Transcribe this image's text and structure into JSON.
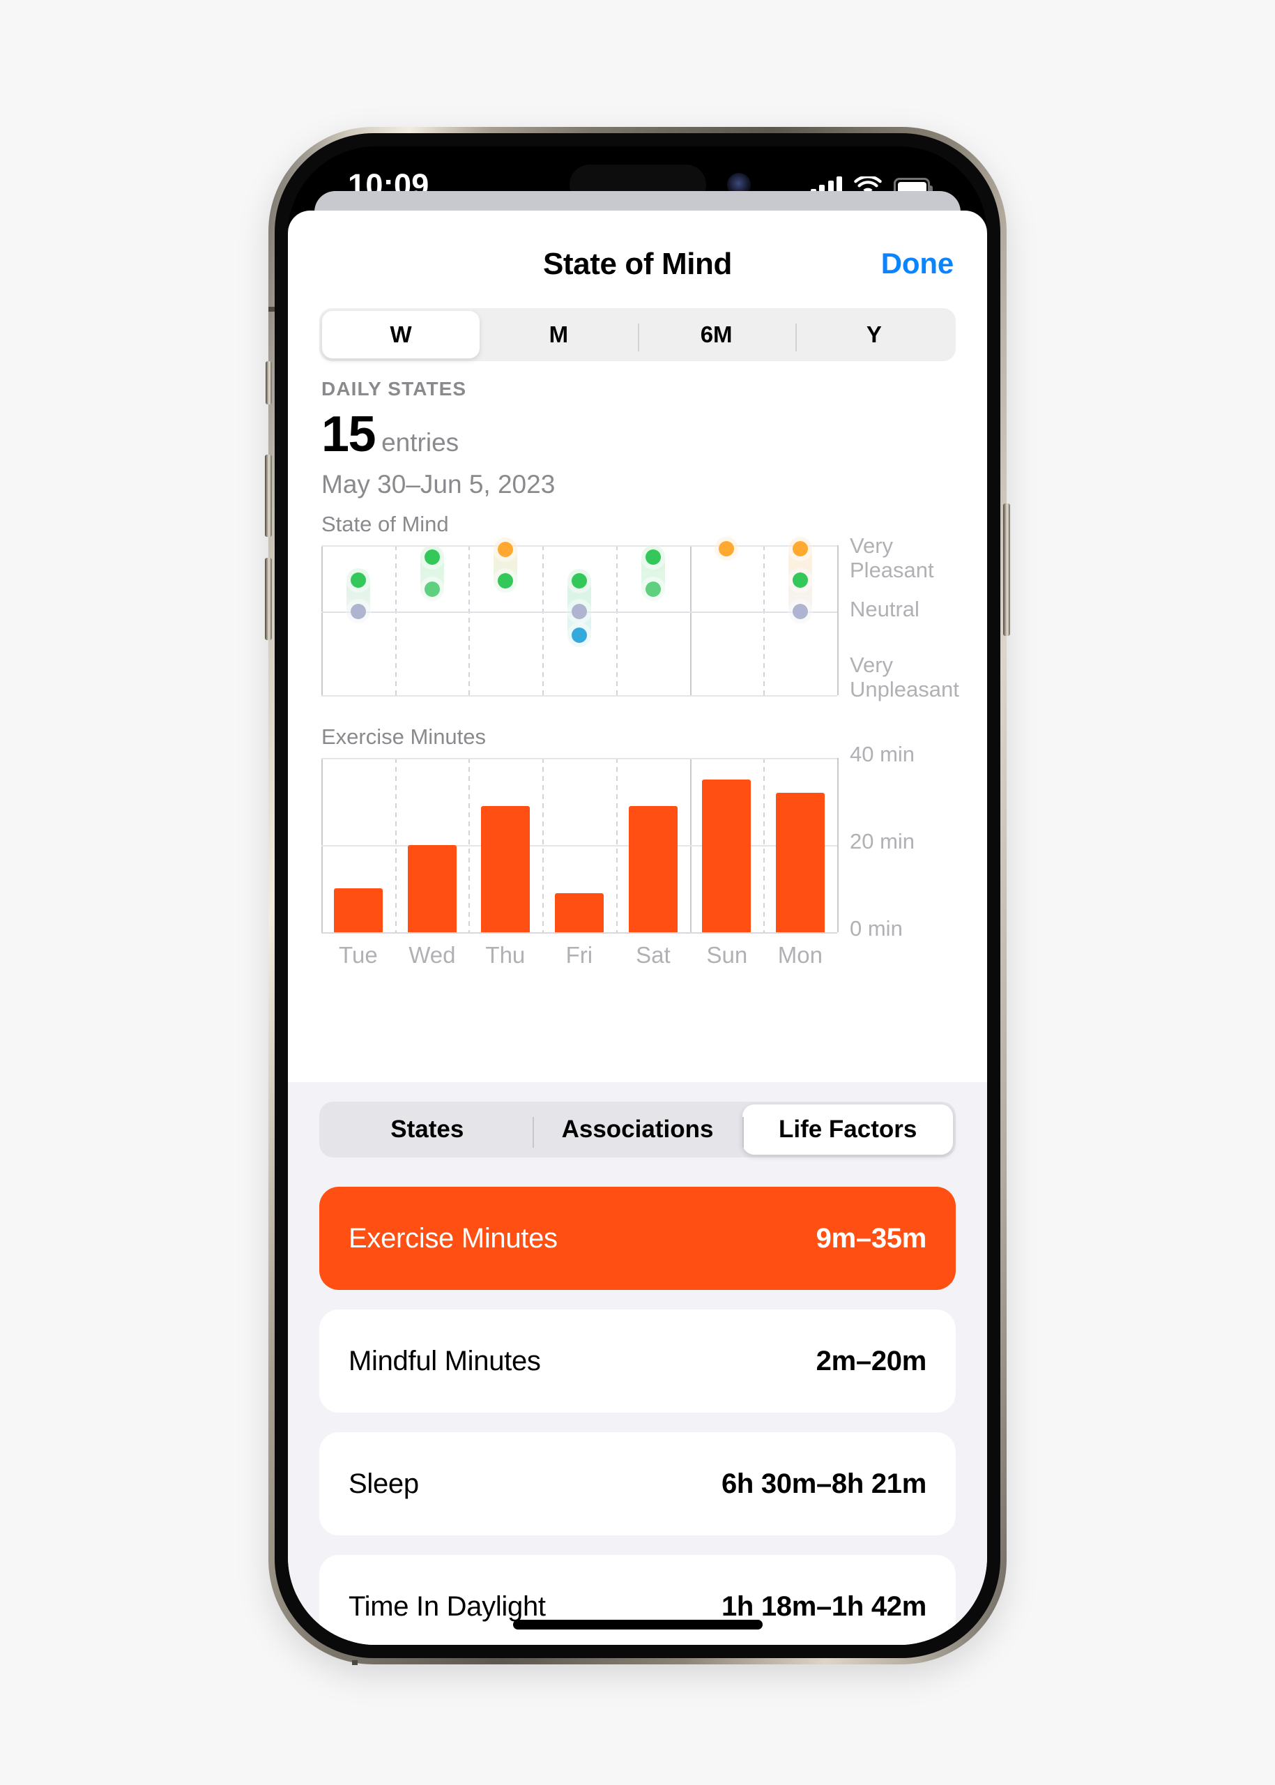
{
  "status_bar": {
    "time": "10:09",
    "cellular_icon": "cellular-bars-icon",
    "wifi_icon": "wifi-icon",
    "battery_icon": "battery-full-icon"
  },
  "nav": {
    "title": "State of Mind",
    "done_label": "Done"
  },
  "range_segments": [
    {
      "label": "W",
      "active": true
    },
    {
      "label": "M",
      "active": false
    },
    {
      "label": "6M",
      "active": false
    },
    {
      "label": "Y",
      "active": false
    }
  ],
  "stats": {
    "section_label": "DAILY STATES",
    "count": "15",
    "unit": "entries",
    "date_range": "May 30–Jun 5, 2023"
  },
  "view_segments": [
    {
      "label": "States",
      "active": false
    },
    {
      "label": "Associations",
      "active": false
    },
    {
      "label": "Life Factors",
      "active": true
    }
  ],
  "life_factors": [
    {
      "name": "Exercise Minutes",
      "value": "9m–35m",
      "highlight": true
    },
    {
      "name": "Mindful Minutes",
      "value": "2m–20m",
      "highlight": false
    },
    {
      "name": "Sleep",
      "value": "6h 30m–8h 21m",
      "highlight": false
    },
    {
      "name": "Time In Daylight",
      "value": "1h 18m–1h 42m",
      "highlight": false
    }
  ],
  "colors": {
    "accent_orange": "#FF4F12",
    "link_blue": "#0A84FF",
    "mood_green": "#34C759",
    "mood_light_green": "#5FD07F",
    "mood_orange": "#FFA930",
    "mood_neutral": "#AFB4D0",
    "mood_blue": "#34AADC",
    "grey_bg": "#F2F2F7"
  },
  "chart_data": [
    {
      "type": "scatter",
      "title": "State of Mind",
      "xlabel": "",
      "ylabel": "",
      "categories": [
        "Tue",
        "Wed",
        "Thu",
        "Fri",
        "Sat",
        "Sun",
        "Mon"
      ],
      "y_tick_labels": [
        "Very Pleasant",
        "Neutral",
        "Very Unpleasant"
      ],
      "ylim": [
        -1,
        1
      ],
      "grid": true,
      "week_separator_before": "Sun",
      "series": [
        {
          "name": "Tue",
          "range": [
            0.0,
            0.46
          ],
          "points": [
            {
              "value": 0.46,
              "color": "#34C759",
              "label": "pleasant"
            },
            {
              "value": 0.0,
              "color": "#AFB4D0",
              "label": "neutral"
            }
          ]
        },
        {
          "name": "Wed",
          "range": [
            0.33,
            0.8
          ],
          "points": [
            {
              "value": 0.8,
              "color": "#34C759",
              "label": "very-pleasant"
            },
            {
              "value": 0.33,
              "color": "#5FD07F",
              "label": "pleasant"
            }
          ]
        },
        {
          "name": "Thu",
          "range": [
            0.45,
            0.92
          ],
          "points": [
            {
              "value": 0.92,
              "color": "#FFA930",
              "label": "very-pleasant"
            },
            {
              "value": 0.45,
              "color": "#34C759",
              "label": "pleasant"
            }
          ]
        },
        {
          "name": "Fri",
          "range": [
            -0.36,
            0.45
          ],
          "points": [
            {
              "value": 0.45,
              "color": "#34C759",
              "label": "pleasant"
            },
            {
              "value": 0.0,
              "color": "#AFB4D0",
              "label": "neutral"
            },
            {
              "value": -0.36,
              "color": "#34AADC",
              "label": "unpleasant"
            }
          ]
        },
        {
          "name": "Sat",
          "range": [
            0.33,
            0.8
          ],
          "points": [
            {
              "value": 0.8,
              "color": "#34C759",
              "label": "very-pleasant"
            },
            {
              "value": 0.33,
              "color": "#5FD07F",
              "label": "pleasant"
            }
          ]
        },
        {
          "name": "Sun",
          "range": [
            0.93,
            0.93
          ],
          "points": [
            {
              "value": 0.93,
              "color": "#FFA930",
              "label": "very-pleasant"
            }
          ]
        },
        {
          "name": "Mon",
          "range": [
            0.0,
            0.93
          ],
          "points": [
            {
              "value": 0.93,
              "color": "#FFA930",
              "label": "very-pleasant"
            },
            {
              "value": 0.46,
              "color": "#34C759",
              "label": "pleasant"
            },
            {
              "value": 0.0,
              "color": "#AFB4D0",
              "label": "neutral"
            }
          ]
        }
      ]
    },
    {
      "type": "bar",
      "title": "Exercise Minutes",
      "xlabel": "",
      "ylabel": "",
      "categories": [
        "Tue",
        "Wed",
        "Thu",
        "Fri",
        "Sat",
        "Sun",
        "Mon"
      ],
      "values": [
        10,
        20,
        29,
        9,
        29,
        35,
        32
      ],
      "y_tick_labels": [
        "40 min",
        "20 min",
        "0 min"
      ],
      "y_ticks": [
        40,
        20,
        0
      ],
      "ylim": [
        0,
        40
      ],
      "bar_color": "#FF4F12",
      "grid": true,
      "week_separator_before": "Sun"
    }
  ]
}
